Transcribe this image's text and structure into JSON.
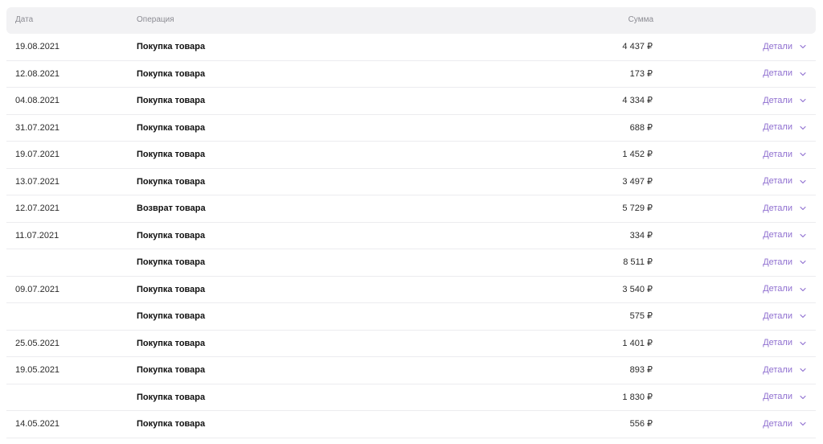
{
  "table": {
    "headers": {
      "date": "Дата",
      "operation": "Операция",
      "amount": "Сумма"
    },
    "details_label": "Детали",
    "accent_color": "#8f6fd0",
    "rows": [
      {
        "date": "19.08.2021",
        "operation": "Покупка товара",
        "amount": "4 437 ₽"
      },
      {
        "date": "12.08.2021",
        "operation": "Покупка товара",
        "amount": "173 ₽"
      },
      {
        "date": "04.08.2021",
        "operation": "Покупка товара",
        "amount": "4 334 ₽"
      },
      {
        "date": "31.07.2021",
        "operation": "Покупка товара",
        "amount": "688 ₽"
      },
      {
        "date": "19.07.2021",
        "operation": "Покупка товара",
        "amount": "1 452 ₽"
      },
      {
        "date": "13.07.2021",
        "operation": "Покупка товара",
        "amount": "3 497 ₽"
      },
      {
        "date": "12.07.2021",
        "operation": "Возврат товара",
        "amount": "5 729 ₽"
      },
      {
        "date": "11.07.2021",
        "operation": "Покупка товара",
        "amount": "334 ₽"
      },
      {
        "date": "",
        "operation": "Покупка товара",
        "amount": "8 511 ₽"
      },
      {
        "date": "09.07.2021",
        "operation": "Покупка товара",
        "amount": "3 540 ₽"
      },
      {
        "date": "",
        "operation": "Покупка товара",
        "amount": "575 ₽"
      },
      {
        "date": "25.05.2021",
        "operation": "Покупка товара",
        "amount": "1 401 ₽"
      },
      {
        "date": "19.05.2021",
        "operation": "Покупка товара",
        "amount": "893 ₽"
      },
      {
        "date": "",
        "operation": "Покупка товара",
        "amount": "1 830 ₽"
      },
      {
        "date": "14.05.2021",
        "operation": "Покупка товара",
        "amount": "556 ₽"
      }
    ]
  }
}
